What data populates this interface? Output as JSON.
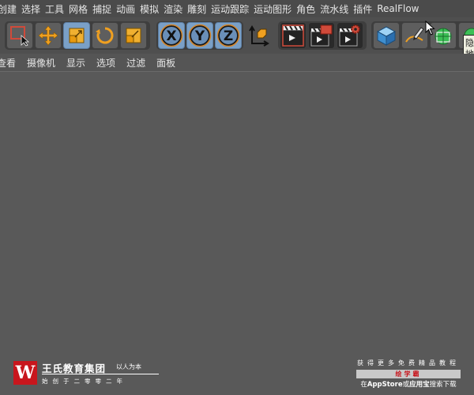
{
  "menu": [
    "创建",
    "选择",
    "工具",
    "网格",
    "捕捉",
    "动画",
    "模拟",
    "渲染",
    "雕刻",
    "运动跟踪",
    "运动图形",
    "角色",
    "流水线",
    "插件",
    "RealFlow"
  ],
  "toolbar": {
    "tools": [
      {
        "name": "live-selection-icon"
      },
      {
        "name": "move-icon"
      },
      {
        "name": "scale-icon"
      },
      {
        "name": "rotate-icon"
      },
      {
        "name": "recent-tool-icon"
      }
    ],
    "axis_locks": [
      "X",
      "Y",
      "Z"
    ],
    "coordinate_system_icon": "world-coordinates-icon",
    "render": [
      {
        "name": "render-view-icon"
      },
      {
        "name": "render-to-picture-viewer-icon"
      },
      {
        "name": "render-settings-icon"
      }
    ],
    "objects": [
      {
        "name": "cube-icon"
      },
      {
        "name": "pen-spline-icon"
      },
      {
        "name": "subdivision-surface-icon"
      }
    ]
  },
  "tooltip": {
    "line1": "隐",
    "line2": "地"
  },
  "viewport_menu": [
    "查看",
    "摄像机",
    "显示",
    "选项",
    "过滤",
    "面板"
  ],
  "branding": {
    "left_mark": "W",
    "left_name": "王氏教育集团",
    "left_slogan": "以人为本",
    "left_sub": "始创于二零零二年",
    "right_top": "获得更多免费精品教程",
    "right_bar": "绘学霸",
    "right_bottom_pre": "在",
    "right_bottom_b1": "AppStore",
    "right_bottom_mid": "或",
    "right_bottom_b2": "应用宝",
    "right_bottom_post": "搜索下载",
    "brand_red": "#c8161d"
  },
  "colors": {
    "menubar_bg": "#4b4b4b",
    "toolbar_bg": "#4f4f4f",
    "viewport_bg": "#595959",
    "active_button": "#7aa0c7"
  }
}
